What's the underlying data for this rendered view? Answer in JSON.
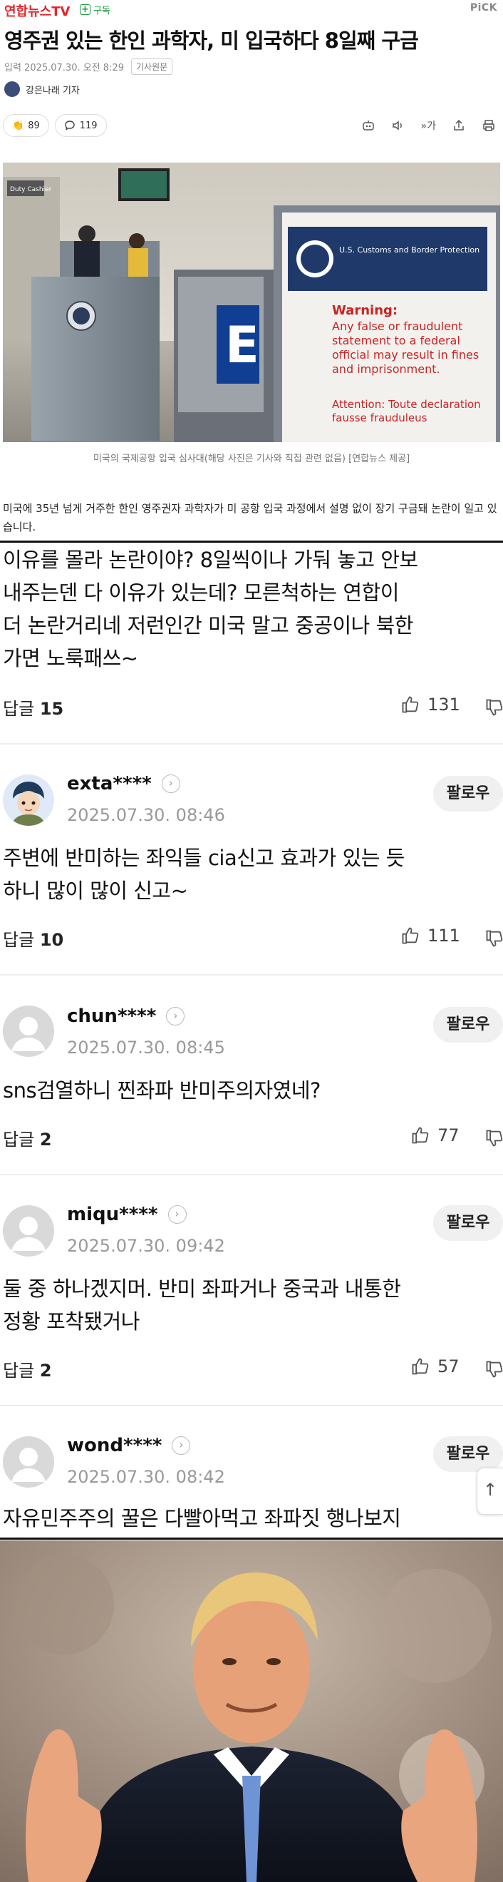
{
  "header": {
    "brand": "연합뉴스TV",
    "subscribe": "구독",
    "pick": "PiCK"
  },
  "article": {
    "title": "영주권 있는 한인 과학자, 미 입국하다 8일째 구금",
    "published": "입력 2025.07.30. 오전 8:29",
    "original_link": "기사원문",
    "reporter": "강은나래 기자",
    "reaction_count": "89",
    "comment_count": "119",
    "font_size_label": "가",
    "caption": "미국의 국제공항 입국 심사대(해당 사진은 기사와 직접 관련 없음) [연합뉴스 제공]",
    "lead": "미국에 35년 넘게 거주한 한인 영주권자 과학자가 미 공항 입국 과정에서 설명 없이 장기 구금돼 논란이 일고 있습니다.",
    "photo_sign_left": "Duty Cashier",
    "photo_sign_e": "E",
    "photo_sign_cbp": "U.S. Customs and Border Protection",
    "photo_warning_title": "Warning:",
    "photo_warning_body": "Any false or fraudulent statement to a federal official may result in fines and imprisonment.",
    "photo_attention": "Attention: Toute declaration fausse frauduleus"
  },
  "comments": [
    {
      "body_lines": [
        "이유를 몰라 논란이야? 8일씩이나 가둬 놓고 안보",
        "내주는덴 다 이유가 있는데? 모른척하는 연합이",
        "더 논란거리네 저런인간 미국 말고 중공이나 북한",
        "가면 노룩패쓰~"
      ],
      "reply_label": "답글",
      "reply_count": "15",
      "likes": "131"
    },
    {
      "user": "exta****",
      "date": "2025.07.30. 08:46",
      "follow": "팔로우",
      "body_lines": [
        "주변에 반미하는 좌익들 cia신고 효과가 있는 듯",
        "하니 많이 많이 신고~"
      ],
      "reply_label": "답글",
      "reply_count": "10",
      "likes": "111"
    },
    {
      "user": "chun****",
      "date": "2025.07.30. 08:45",
      "follow": "팔로우",
      "body_lines": [
        "sns검열하니 찐좌파 반미주의자였네?"
      ],
      "reply_label": "답글",
      "reply_count": "2",
      "likes": "77"
    },
    {
      "user": "miqu****",
      "date": "2025.07.30. 09:42",
      "follow": "팔로우",
      "body_lines": [
        "둘 중 하나겠지머. 반미 좌파거나 중국과 내통한",
        "정황 포착됐거나"
      ],
      "reply_label": "답글",
      "reply_count": "2",
      "likes": "57"
    },
    {
      "user": "wond****",
      "date": "2025.07.30. 08:42",
      "follow": "팔로우",
      "body_lines": [
        "자유민주주의 꿀은 다빨아먹고 좌파짓 행나보지"
      ]
    }
  ],
  "icons": {
    "like": "thumbs-up-icon",
    "dislike": "thumbs-down-icon",
    "comment": "speech-bubble-icon",
    "chevron": "chevron-right-icon",
    "scroll_top": "arrow-up-icon"
  }
}
